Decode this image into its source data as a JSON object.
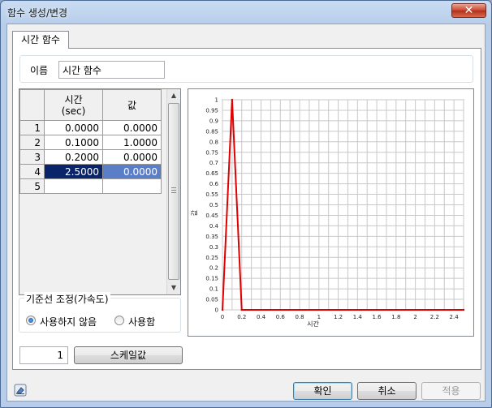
{
  "window": {
    "title": "함수 생성/변경",
    "close_glyph": "✕"
  },
  "tabs": [
    {
      "label": "시간 함수"
    }
  ],
  "name_field": {
    "label": "이름",
    "value": "시간 함수"
  },
  "table": {
    "col1_header_line1": "시간",
    "col1_header_line2": "(sec)",
    "col2_header": "값",
    "rows": [
      {
        "index": "1",
        "time": "0.0000",
        "value": "0.0000"
      },
      {
        "index": "2",
        "time": "0.1000",
        "value": "1.0000"
      },
      {
        "index": "3",
        "time": "0.2000",
        "value": "0.0000"
      },
      {
        "index": "4",
        "time": "2.5000",
        "value": "0.0000"
      },
      {
        "index": "5",
        "time": "",
        "value": ""
      }
    ],
    "selected_row": "4"
  },
  "baseline": {
    "legend": "기준선 조정(가속도)",
    "option_off": "사용하지 않음",
    "option_on": "사용함",
    "selected": "사용하지 않음"
  },
  "scale": {
    "value": "1",
    "button_label": "스케일값"
  },
  "buttons": {
    "ok": "확인",
    "cancel": "취소",
    "apply": "적용"
  },
  "colors": {
    "series": "#e00000",
    "grid": "#c8c8c8",
    "selected_row": "#0a246a"
  },
  "chart_data": {
    "type": "line",
    "xlabel": "시간",
    "ylabel": "값",
    "xlim": [
      0,
      2.5
    ],
    "ylim": [
      0,
      1
    ],
    "x_ticks": [
      "0",
      "0.2",
      "0.4",
      "0.6",
      "0.8",
      "1",
      "1.2",
      "1.4",
      "1.6",
      "1.8",
      "2",
      "2.2",
      "2.4"
    ],
    "y_ticks": [
      "0",
      "0.05",
      "0.1",
      "0.15",
      "0.2",
      "0.25",
      "0.3",
      "0.35",
      "0.4",
      "0.45",
      "0.5",
      "0.55",
      "0.6",
      "0.65",
      "0.7",
      "0.75",
      "0.8",
      "0.85",
      "0.9",
      "0.95",
      "1"
    ],
    "grid": true,
    "series": [
      {
        "x": [
          0,
          0.1,
          0.2,
          2.5
        ],
        "y": [
          0,
          1,
          0,
          0
        ]
      }
    ]
  }
}
